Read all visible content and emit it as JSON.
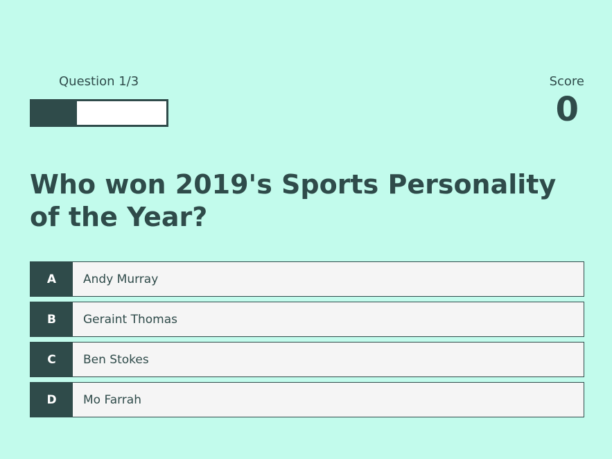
{
  "hud": {
    "progress_text": "Question 1/3",
    "progress_fraction": 0.333,
    "score_label": "Score",
    "score_value": "0"
  },
  "question": "Who won 2019's Sports Personality of the Year?",
  "choices": [
    {
      "prefix": "A",
      "text": "Andy Murray"
    },
    {
      "prefix": "B",
      "text": "Geraint Thomas"
    },
    {
      "prefix": "C",
      "text": "Ben Stokes"
    },
    {
      "prefix": "D",
      "text": "Mo Farrah"
    }
  ],
  "colors": {
    "background": "#c2fbec",
    "primary": "#2f4b4a",
    "choice_background": "#f5f5f5"
  }
}
